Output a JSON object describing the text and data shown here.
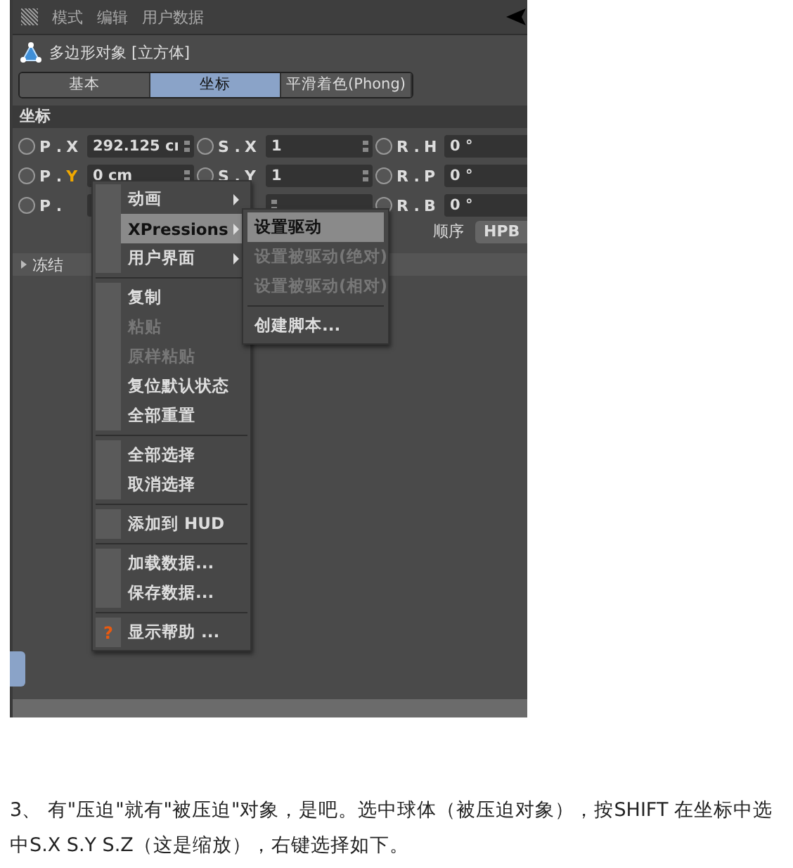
{
  "app_screenshot": {
    "menubar": {
      "items": [
        "模式",
        "编辑",
        "用户数据"
      ]
    },
    "object_title": "多边形对象 [立方体]",
    "tabs": [
      {
        "label": "基本",
        "selected": false
      },
      {
        "label": "坐标",
        "selected": true
      },
      {
        "label": "平滑着色(Phong)",
        "selected": false
      }
    ],
    "section": "坐标",
    "rows": [
      [
        {
          "checked": false,
          "prefix": "P .",
          "axis": "X",
          "axis_highlighted": false,
          "value": "292.125 cı"
        },
        {
          "checked": false,
          "prefix": "S .",
          "axis": "X",
          "axis_highlighted": false,
          "value": "1"
        },
        {
          "checked": false,
          "prefix": "R .",
          "axis": "H",
          "axis_highlighted": false,
          "value": "0 °"
        }
      ],
      [
        {
          "checked": false,
          "prefix": "P .",
          "axis": "Y",
          "axis_highlighted": true,
          "value": "0 cm"
        },
        {
          "checked": false,
          "prefix": "S .",
          "axis": "Y",
          "axis_highlighted": false,
          "value": "1"
        },
        {
          "checked": false,
          "prefix": "R .",
          "axis": "P",
          "axis_highlighted": false,
          "value": "0 °"
        }
      ],
      [
        {
          "checked": false,
          "prefix": "P ."
        },
        {},
        {
          "checked": false,
          "prefix": "R .",
          "axis": "B",
          "axis_highlighted": false,
          "value": "0 °"
        }
      ]
    ],
    "order": {
      "label": "顺序",
      "value": "HPB"
    },
    "collapsed_section": "冻结",
    "context_menu": [
      {
        "kind": "item",
        "label": "动画",
        "submenu": true,
        "disabled": false,
        "selected": false
      },
      {
        "kind": "item",
        "label": "XPressions",
        "submenu": true,
        "disabled": false,
        "selected": true
      },
      {
        "kind": "item",
        "label": "用户界面",
        "submenu": true,
        "disabled": false,
        "selected": false
      },
      {
        "kind": "separator"
      },
      {
        "kind": "item",
        "label": "复制",
        "submenu": false,
        "disabled": false,
        "selected": false
      },
      {
        "kind": "item",
        "label": "粘贴",
        "submenu": false,
        "disabled": true,
        "selected": false
      },
      {
        "kind": "item",
        "label": "原样粘贴",
        "submenu": false,
        "disabled": true,
        "selected": false
      },
      {
        "kind": "item",
        "label": "复位默认状态",
        "submenu": false,
        "disabled": false,
        "selected": false
      },
      {
        "kind": "item",
        "label": "全部重置",
        "submenu": false,
        "disabled": false,
        "selected": false
      },
      {
        "kind": "separator"
      },
      {
        "kind": "item",
        "label": "全部选择",
        "submenu": false,
        "disabled": false,
        "selected": false
      },
      {
        "kind": "item",
        "label": "取消选择",
        "submenu": false,
        "disabled": false,
        "selected": false
      },
      {
        "kind": "separator"
      },
      {
        "kind": "item",
        "label": "添加到 HUD",
        "submenu": false,
        "disabled": false,
        "selected": false
      },
      {
        "kind": "separator"
      },
      {
        "kind": "item",
        "label": "加载数据...",
        "submenu": false,
        "disabled": false,
        "selected": false
      },
      {
        "kind": "item",
        "label": "保存数据...",
        "submenu": false,
        "disabled": false,
        "selected": false
      },
      {
        "kind": "separator"
      },
      {
        "kind": "item",
        "label": "显示帮助 ...",
        "icon": "?",
        "submenu": false,
        "disabled": false,
        "selected": false
      }
    ],
    "submenu": [
      {
        "kind": "item",
        "label": "设置驱动",
        "disabled": false,
        "selected": true
      },
      {
        "kind": "item",
        "label": "设置被驱动(绝对)",
        "disabled": true,
        "selected": false
      },
      {
        "kind": "item",
        "label": "设置被驱动(相对)",
        "disabled": true,
        "selected": false
      },
      {
        "kind": "separator"
      },
      {
        "kind": "item",
        "label": "创建脚本...",
        "disabled": false,
        "selected": false
      }
    ]
  },
  "paragraph": "3、 有\"压迫\"就有\"被压迫\"对象，是吧。选中球体（被压迫对象），按SHIFT 在坐标中选中S.X S.Y S.Z（这是缩放），右键选择如下。"
}
